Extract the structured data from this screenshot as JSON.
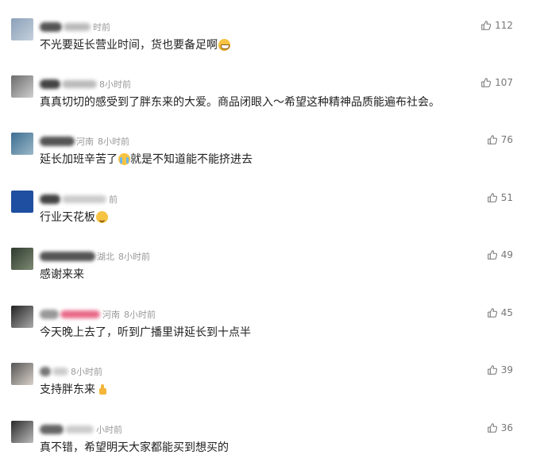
{
  "comments": [
    {
      "location": "",
      "time": "时前",
      "text": "不光要延长营业时间，货也要备足啊",
      "emoji": "grin",
      "likes": "112",
      "avatar": [
        "#8aa0b8",
        "#c5d0dc"
      ],
      "blur": [
        "#555",
        "#bbb"
      ],
      "blurW": [
        28,
        34
      ]
    },
    {
      "location": "",
      "time": "8小时前",
      "text": "真真切切的感受到了胖东来的大爱。商品闭眼入～希望这种精神品质能遍布社会。",
      "emoji": "",
      "likes": "107",
      "avatar": [
        "#6b6b6b",
        "#cfcfcf"
      ],
      "blur": [
        "#444",
        "#bbb"
      ],
      "blurW": [
        26,
        44
      ]
    },
    {
      "location": "河南",
      "time": "8小时前",
      "text": "延长加班辛苦了",
      "text2": "就是不知道能不能挤进去",
      "emoji": "cry",
      "likes": "76",
      "avatar": [
        "#3c6e91",
        "#9ab7c7"
      ],
      "blur": [
        "#555",
        "#bbb"
      ],
      "blurW": [
        44,
        0
      ]
    },
    {
      "location": "",
      "time": "前",
      "text": "行业天花板",
      "emoji": "smile",
      "likes": "51",
      "avatar": [
        "#1f4fa0",
        "#1f4fa0"
      ],
      "blur": [
        "#444",
        "#ccc"
      ],
      "blurW": [
        26,
        56
      ]
    },
    {
      "location": "湖北",
      "time": "8小时前",
      "text": "感谢来来",
      "emoji": "",
      "likes": "49",
      "avatar": [
        "#2e3a2e",
        "#7d8a72"
      ],
      "blur": [
        "#555",
        "#bbb"
      ],
      "blurW": [
        70,
        0
      ]
    },
    {
      "location": "河南",
      "time": "8小时前",
      "text": "今天晚上去了，听到广播里讲延长到十点半",
      "emoji": "",
      "likes": "45",
      "avatar": [
        "#222",
        "#aaa"
      ],
      "blur": [
        "#999",
        "#e86a8a"
      ],
      "blurW": [
        24,
        50
      ]
    },
    {
      "location": "",
      "time": "8小时前",
      "text": "支持胖东来",
      "emoji": "thumb",
      "likes": "39",
      "avatar": [
        "#555",
        "#d8d0c8"
      ],
      "blur": [
        "#777",
        "#ccc"
      ],
      "blurW": [
        14,
        20
      ]
    },
    {
      "location": "",
      "time": "小时前",
      "text": "真不错，希望明天大家都能买到想买的",
      "emoji": "",
      "likes": "36",
      "avatar": [
        "#2a2a2a",
        "#bbb"
      ],
      "blur": [
        "#666",
        "#ccc"
      ],
      "blurW": [
        30,
        36
      ]
    }
  ]
}
